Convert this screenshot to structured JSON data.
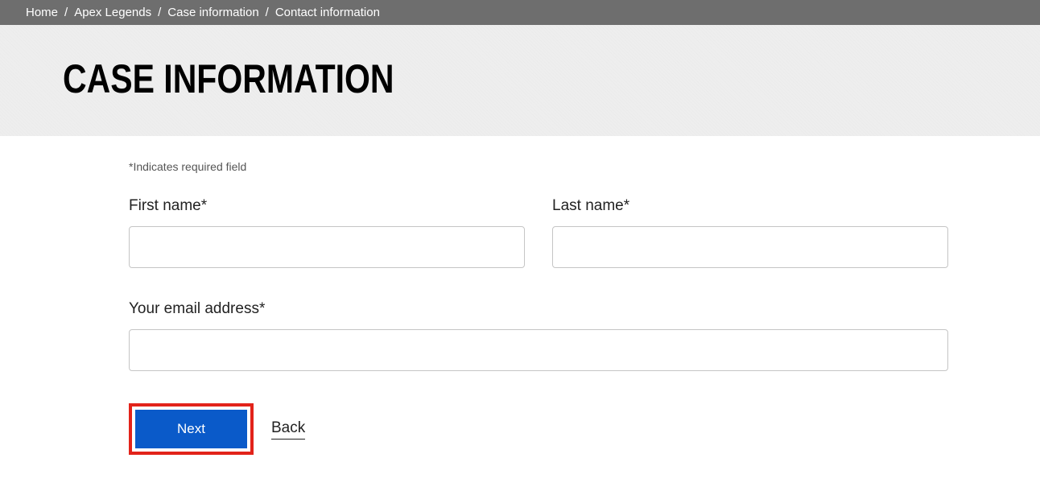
{
  "breadcrumb": {
    "items": [
      "Home",
      "Apex Legends",
      "Case information",
      "Contact information"
    ],
    "separator": "/"
  },
  "page": {
    "title": "CASE INFORMATION",
    "required_note": "*Indicates required field"
  },
  "form": {
    "first_name": {
      "label": "First name*",
      "value": ""
    },
    "last_name": {
      "label": "Last name*",
      "value": ""
    },
    "email": {
      "label": "Your email address*",
      "value": ""
    }
  },
  "buttons": {
    "next": "Next",
    "back": "Back"
  }
}
